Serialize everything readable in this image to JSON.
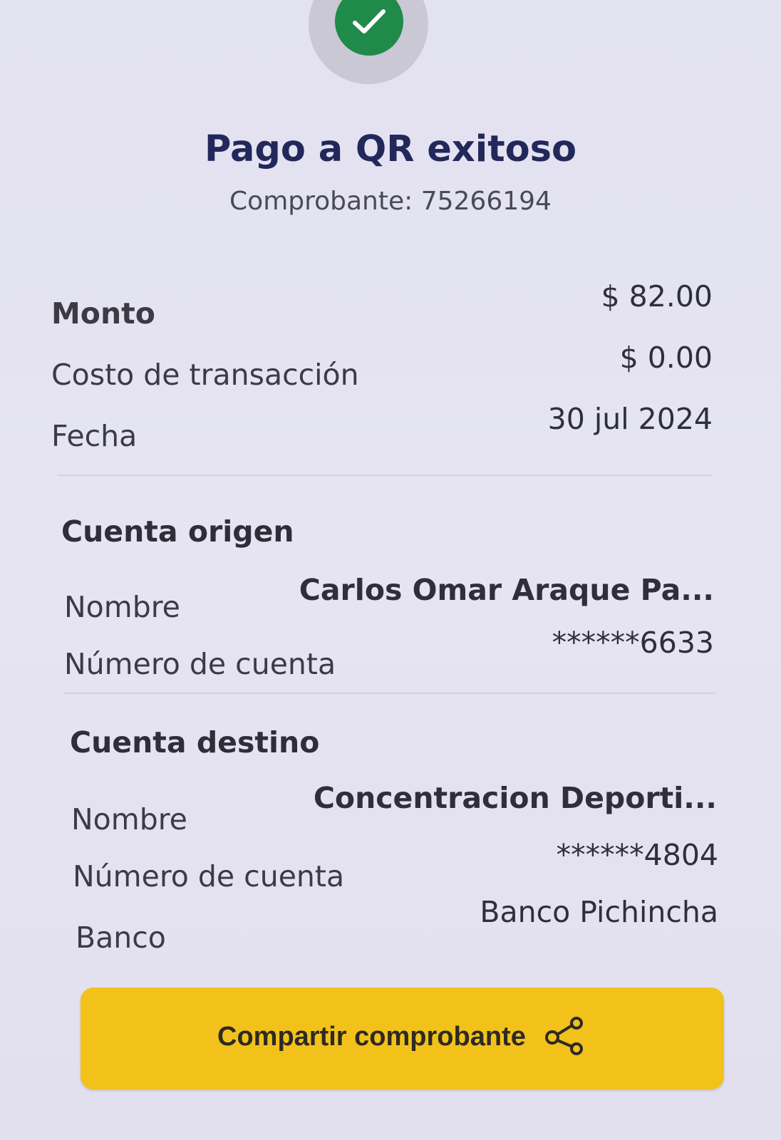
{
  "header": {
    "status_icon": "check-icon",
    "title": "Pago a QR exitoso",
    "receipt": "Comprobante: 75266194"
  },
  "summary": {
    "amount_label": "Monto",
    "amount_value": "$ 82.00",
    "fee_label": "Costo de transacción",
    "fee_value": "$ 0.00",
    "date_label": "Fecha",
    "date_value": "30 jul 2024"
  },
  "origin": {
    "section_title": "Cuenta origen",
    "name_label": "Nombre",
    "name_value": "Carlos Omar Araque Pa...",
    "account_label": "Número de cuenta",
    "account_value": "******6633"
  },
  "destination": {
    "section_title": "Cuenta destino",
    "name_label": "Nombre",
    "name_value": "Concentracion Deporti...",
    "account_label": "Número de cuenta",
    "account_value": "******4804",
    "bank_label": "Banco",
    "bank_value": "Banco Pichincha"
  },
  "actions": {
    "share_label": "Compartir comprobante",
    "share_icon": "share-icon"
  },
  "colors": {
    "success": "#1f8a49",
    "title": "#22285a",
    "button": "#f2c21b",
    "background": "#e4e2f0"
  }
}
